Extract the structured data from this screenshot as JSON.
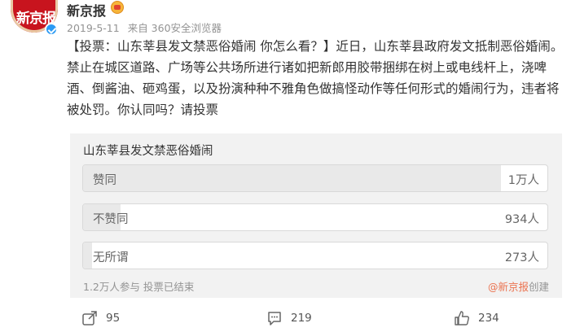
{
  "colors": {
    "accent": "#eb7350",
    "verify": "#2b9af3",
    "avatar": "#c8141e",
    "poll_bg": "#f2f2f2"
  },
  "post": {
    "avatar_text": "新京报",
    "username": "新京报",
    "date": "2019-5-11",
    "source": "来自 360安全浏览器",
    "text": "【投票：山东莘县发文禁恶俗婚闹 你怎么看？】近日，山东莘县政府发文抵制恶俗婚闹。禁止在城区道路、广场等公共场所进行诸如把新郎用胶带捆绑在树上或电线杆上，浇啤酒、倒酱油、砸鸡蛋，以及扮演种种不雅角色做搞怪动作等任何形式的婚闹行为，违者将被处罚。你认同吗？请投票"
  },
  "poll": {
    "title": "山东莘县发文禁恶俗婚闹",
    "options": [
      {
        "label": "赞同",
        "count": "1万人",
        "share": 0.9
      },
      {
        "label": "不赞同",
        "count": "934人",
        "share": 0.08
      },
      {
        "label": "无所谓",
        "count": "273人",
        "share": 0.02
      }
    ],
    "participants": "1.2万人参与",
    "status": "投票已结束",
    "creator": "@新京报",
    "created_label": "创建"
  },
  "actions": {
    "share": {
      "icon": "share-icon",
      "count": "95"
    },
    "comment": {
      "icon": "comment-icon",
      "count": "219"
    },
    "like": {
      "icon": "like-icon",
      "count": "234"
    }
  }
}
